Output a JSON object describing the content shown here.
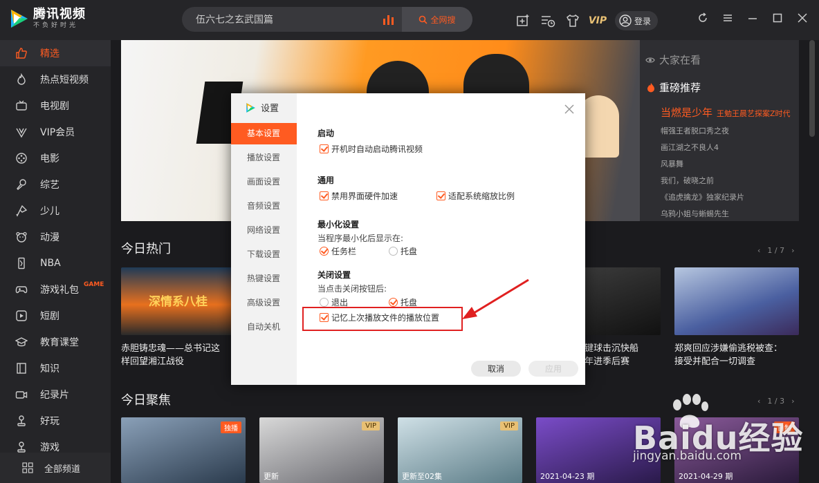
{
  "app": {
    "title": "腾讯视频",
    "slogan": "不负好时光"
  },
  "search": {
    "query": "伍六七之玄武国篇",
    "button_label": "全网搜"
  },
  "header": {
    "vip_label": "VIP",
    "login_label": "登录"
  },
  "sidebar": {
    "items": [
      {
        "label": "精选",
        "icon": "thumbs-up-icon",
        "active": true
      },
      {
        "label": "热点短视频",
        "icon": "flame-icon"
      },
      {
        "label": "电视剧",
        "icon": "tv-icon"
      },
      {
        "label": "VIP会员",
        "icon": "vip-icon"
      },
      {
        "label": "电影",
        "icon": "film-reel-icon"
      },
      {
        "label": "综艺",
        "icon": "microphone-icon"
      },
      {
        "label": "少儿",
        "icon": "kite-icon"
      },
      {
        "label": "动漫",
        "icon": "bear-icon"
      },
      {
        "label": "NBA",
        "icon": "nba-icon"
      },
      {
        "label": "游戏礼包",
        "icon": "gamepad-icon",
        "badge": "GAME"
      },
      {
        "label": "短剧",
        "icon": "play-square-icon"
      },
      {
        "label": "教育课堂",
        "icon": "graduation-cap-icon"
      },
      {
        "label": "知识",
        "icon": "book-icon"
      },
      {
        "label": "纪录片",
        "icon": "camera-icon"
      },
      {
        "label": "好玩",
        "icon": "joystick-icon"
      },
      {
        "label": "游戏",
        "icon": "joystick-icon"
      }
    ],
    "all_channels": "全部频道"
  },
  "recommend": {
    "header": "大家在看",
    "hot_title": "重磅推荐",
    "highlight": "当燃是少年",
    "highlight_sub": "王勉王晨艺探案Z时代",
    "items": [
      "帽强王者脱口秀之夜",
      "画江湖之不良人4",
      "风暴舞",
      "我们，破晓之前",
      "《追虎擒龙》独家纪录片",
      "乌鸦小姐与蜥蜴先生"
    ]
  },
  "sections": {
    "hot_title": "今日热门",
    "hot_pager": "1 / 7",
    "focus_title": "今日聚焦",
    "focus_pager": "1 / 3"
  },
  "hot_cards": [
    {
      "title": "赤胆铸忠魂——总书记这",
      "title2": "样回望湘江战役",
      "caption": "深情系八桂"
    },
    {
      "title": "键球击沉快船",
      "title2": "年进季后赛"
    },
    {
      "title": "郑爽回应涉嫌偷逃税被查：",
      "title2": "接受并配合一切调查"
    }
  ],
  "focus_cards": [
    {
      "badge": "独播",
      "caption": ""
    },
    {
      "badge": "VIP",
      "caption": "更新"
    },
    {
      "badge": "VIP",
      "caption": "更新至02集"
    },
    {
      "badge": "",
      "caption": "2021-04-23 期"
    },
    {
      "badge": "自制",
      "caption": "2021-04-29 期"
    }
  ],
  "dialog": {
    "title": "设置",
    "tabs": [
      "基本设置",
      "播放设置",
      "画面设置",
      "音频设置",
      "网络设置",
      "下载设置",
      "热键设置",
      "高级设置",
      "自动关机"
    ],
    "startup_title": "启动",
    "startup_opt": "开机时自动启动腾讯视频",
    "general_title": "通用",
    "general_opt1": "禁用界面硬件加速",
    "general_opt2": "适配系统缩放比例",
    "minimize_title": "最小化设置",
    "minimize_sub": "当程序最小化后显示在:",
    "minimize_opt1": "任务栏",
    "minimize_opt2": "托盘",
    "close_title": "关闭设置",
    "close_sub": "当点击关闭按钮后:",
    "close_opt1": "退出",
    "close_opt2": "托盘",
    "remember_opt": "记忆上次播放文件的播放位置",
    "cancel": "取消",
    "apply": "应用"
  },
  "watermark": {
    "text": "Baidu经验",
    "url": "jingyan.baidu.com"
  },
  "colors": {
    "accent": "#ff5b21",
    "background": "#1b1b1e",
    "highlight_box": "#e02020"
  }
}
